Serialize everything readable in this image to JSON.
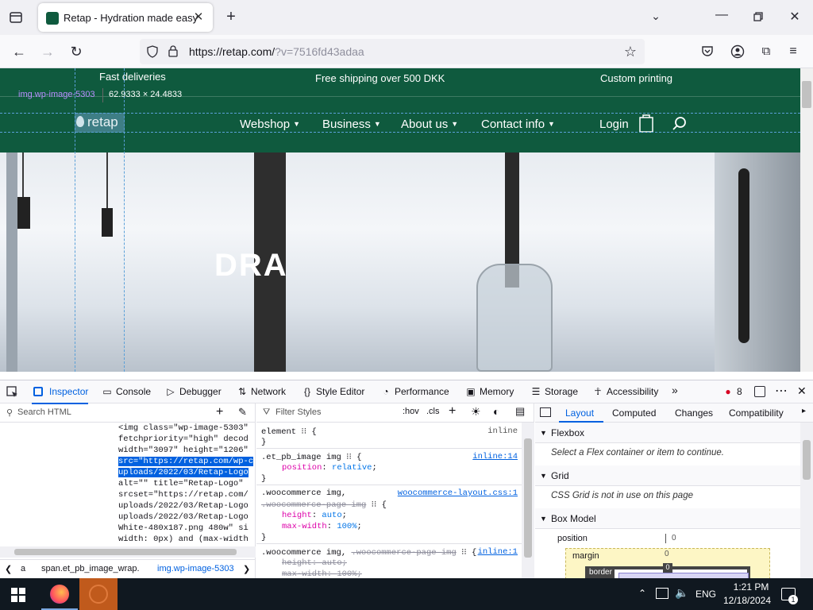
{
  "browser": {
    "tab_title": "Retap - Hydration made easy",
    "url_main": "https://retap.com/",
    "url_rest": "?v=7516fd43adaa"
  },
  "site": {
    "topbar": [
      "Fast deliveries",
      "Free shipping over 500 DKK",
      "Custom printing"
    ],
    "logo_text": "retap",
    "nav": [
      "Webshop",
      "Business",
      "About us",
      "Contact info"
    ],
    "login": "Login",
    "hero_text": "DRA"
  },
  "overlay": {
    "selector": "img.wp-image-5303",
    "dimensions": "62.9333 × 24.4833"
  },
  "devtools": {
    "tabs": [
      "Inspector",
      "Console",
      "Debugger",
      "Network",
      "Style Editor",
      "Performance",
      "Memory",
      "Storage",
      "Accessibility"
    ],
    "error_count": "8",
    "search_html_placeholder": "Search HTML",
    "filter_styles_placeholder": "Filter Styles",
    "hov": ":hov",
    "cls": ".cls",
    "html_lines": [
      "<img class=\"wp-image-5303\"",
      "fetchpriority=\"high\" decod",
      "width=\"3097\" height=\"1206\"",
      "src=\"https://retap.com/wp-c",
      "uploads/2022/03/Retap-Logo",
      "alt=\"\" title=\"Retap-Logo\"",
      "srcset=\"https://retap.com/",
      "uploads/2022/03/Retap-Logo",
      "uploads/2022/03/Retap-Logo",
      "White-480x187.png 480w\" si",
      "width: 0px) and (max-width"
    ],
    "breadcrumb": [
      "a",
      "span.et_pb_image_wrap.",
      "img.wp-image-5303"
    ],
    "css_rules": {
      "element_selector": "element",
      "element_source": "inline",
      "rule1_selector": ".et_pb_image img",
      "rule1_source": "inline:14",
      "rule1_prop": "position",
      "rule1_val": "relative",
      "rule2_selector": ".woocommerce img,",
      "rule2_selector_b": ".woocommerce-page img",
      "rule2_source": "woocommerce-layout.css:1",
      "rule2_props": [
        [
          "height",
          "auto"
        ],
        [
          "max-width",
          "100%"
        ]
      ],
      "rule3_selector": ".woocommerce img,",
      "rule3_selector_b": ".woocommerce-page img",
      "rule3_source": "inline:1",
      "rule3_props": [
        [
          "height",
          "auto"
        ],
        [
          "max-width",
          "100%"
        ]
      ]
    },
    "layout_tabs": [
      "Layout",
      "Computed",
      "Changes",
      "Compatibility"
    ],
    "layout_sections": {
      "flexbox": "Flexbox",
      "flexbox_msg": "Select a Flex container or item to continue.",
      "grid": "Grid",
      "grid_msg": "CSS Grid is not in use on this page",
      "boxmodel": "Box Model",
      "position_label": "position",
      "position_val": "0",
      "margin_label": "margin",
      "margin_val": "0",
      "border_label": "border",
      "border_val": "0"
    }
  },
  "taskbar": {
    "lang": "ENG",
    "time": "1:21 PM",
    "date": "12/18/2024"
  },
  "colors": {
    "brand_green": "#0f5a3e",
    "devtools_accent": "#0061e0"
  }
}
